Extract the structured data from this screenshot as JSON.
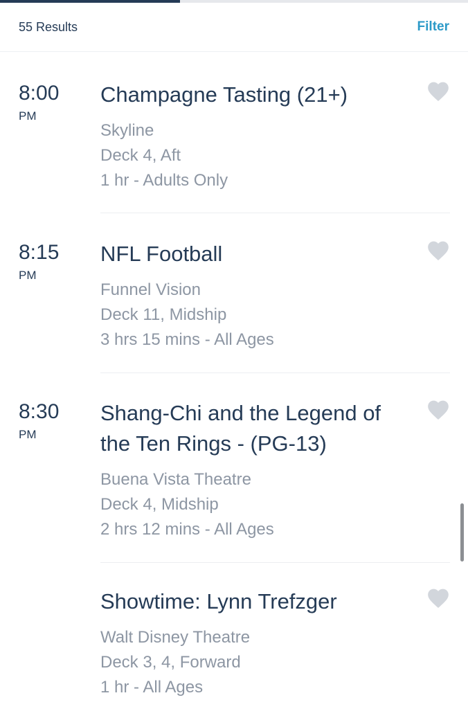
{
  "progress": 0.385,
  "header": {
    "results_label": "55 Results",
    "filter_label": "Filter"
  },
  "events": [
    {
      "time": "8:00",
      "ampm": "PM",
      "title_lines": [
        "Champagne Tasting (21+)"
      ],
      "venue": "Skyline",
      "location": "Deck 4, Aft",
      "duration": "1 hr - Adults Only"
    },
    {
      "time": "8:15",
      "ampm": "PM",
      "title_lines": [
        "NFL Football"
      ],
      "venue": "Funnel Vision",
      "location": "Deck 11, Midship",
      "duration": "3 hrs 15 mins - All Ages"
    },
    {
      "time": "8:30",
      "ampm": "PM",
      "title_lines": [
        "Shang-Chi and the Legend of",
        "the Ten Rings - (PG-13)"
      ],
      "venue": "Buena Vista Theatre",
      "location": "Deck 4, Midship",
      "duration": "2 hrs 12 mins - All Ages"
    },
    {
      "time": "",
      "ampm": "",
      "title_lines": [
        "Showtime: Lynn Trefzger"
      ],
      "venue": "Walt Disney Theatre",
      "location": "Deck 3, 4, Forward",
      "duration": "1 hr - All Ages"
    }
  ],
  "icons": {
    "favorite": "heart-icon"
  },
  "colors": {
    "title": "#253b56",
    "meta": "#8d96a3",
    "accent": "#2c9ac8",
    "heart": "#d2d6dc"
  }
}
